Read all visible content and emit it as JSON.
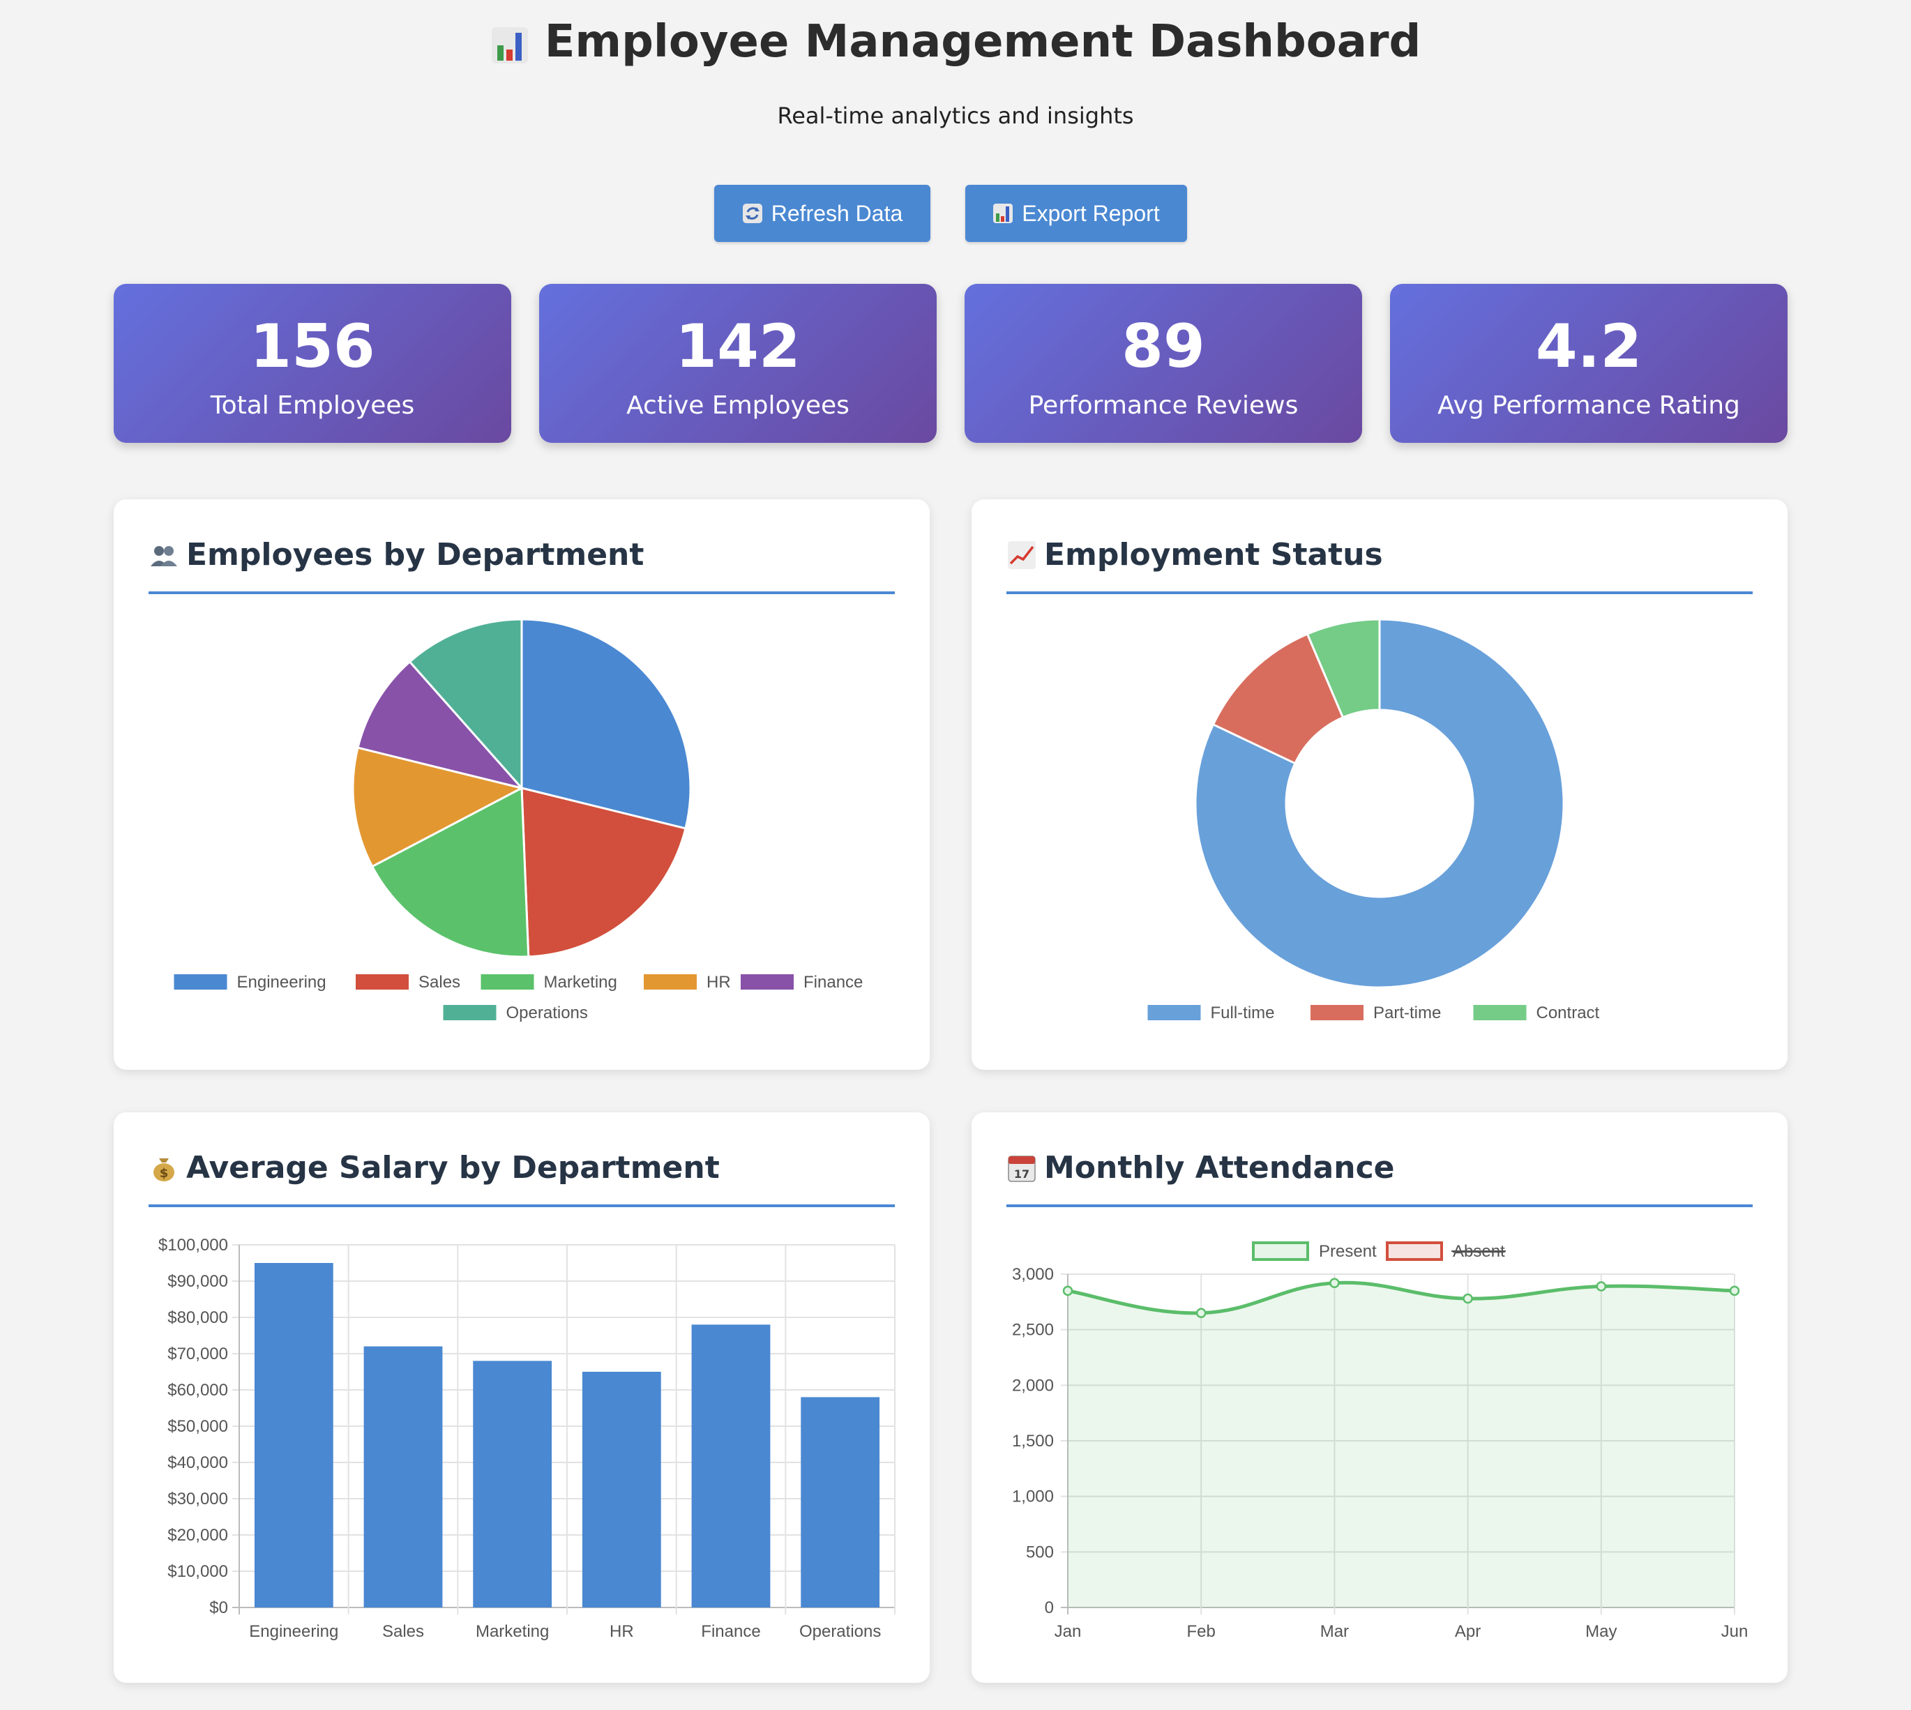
{
  "header": {
    "title": "Employee Management Dashboard",
    "subtitle": "Real-time analytics and insights"
  },
  "actions": {
    "refresh_label": "Refresh Data",
    "export_label": "Export Report"
  },
  "stats": [
    {
      "value": "156",
      "label": "Total Employees"
    },
    {
      "value": "142",
      "label": "Active Employees"
    },
    {
      "value": "89",
      "label": "Performance Reviews"
    },
    {
      "value": "4.2",
      "label": "Avg Performance Rating"
    }
  ],
  "cards": {
    "department": {
      "title": "Employees by Department",
      "icon": "people-icon"
    },
    "status": {
      "title": "Employment Status",
      "icon": "chart-up-icon"
    },
    "salary": {
      "title": "Average Salary by Department",
      "icon": "money-bag-icon"
    },
    "attendance": {
      "title": "Monthly Attendance",
      "icon": "calendar-icon"
    }
  },
  "chart_data": [
    {
      "type": "pie",
      "title": "Employees by Department",
      "categories": [
        "Engineering",
        "Sales",
        "Marketing",
        "HR",
        "Finance",
        "Operations"
      ],
      "values": [
        45,
        32,
        28,
        18,
        15,
        18
      ],
      "colors": [
        "#4a88d2",
        "#d14f3c",
        "#5bc26b",
        "#e39731",
        "#8852a9",
        "#50b096"
      ],
      "legend": "bottom"
    },
    {
      "type": "pie",
      "subtype": "doughnut",
      "title": "Employment Status",
      "categories": [
        "Full-time",
        "Part-time",
        "Contract"
      ],
      "values": [
        128,
        18,
        10
      ],
      "colors": [
        "#68a0da",
        "#d86d5e",
        "#74cc87"
      ],
      "legend": "bottom"
    },
    {
      "type": "bar",
      "title": "Average Salary by Department",
      "categories": [
        "Engineering",
        "Sales",
        "Marketing",
        "HR",
        "Finance",
        "Operations"
      ],
      "values": [
        95000,
        72000,
        68000,
        65000,
        78000,
        58000
      ],
      "ylim": [
        0,
        100000
      ],
      "yticks": [
        "$0",
        "$10,000",
        "$20,000",
        "$30,000",
        "$40,000",
        "$50,000",
        "$60,000",
        "$70,000",
        "$80,000",
        "$90,000",
        "$100,000"
      ],
      "color": "#4a88d2",
      "grid": true
    },
    {
      "type": "line",
      "title": "Monthly Attendance",
      "x": [
        "Jan",
        "Feb",
        "Mar",
        "Apr",
        "May",
        "Jun"
      ],
      "ylim": [
        0,
        3000
      ],
      "yticks": [
        "0",
        "500",
        "1,000",
        "1,500",
        "2,000",
        "2,500",
        "3,000"
      ],
      "series": [
        {
          "name": "Present",
          "values": [
            2850,
            2650,
            2920,
            2780,
            2890,
            2850
          ],
          "color": "#5bbd6a",
          "fill": true,
          "hidden": false
        },
        {
          "name": "Absent",
          "values": [],
          "color": "#d14f3c",
          "hidden": true
        }
      ],
      "legend": "top",
      "grid": true
    }
  ]
}
